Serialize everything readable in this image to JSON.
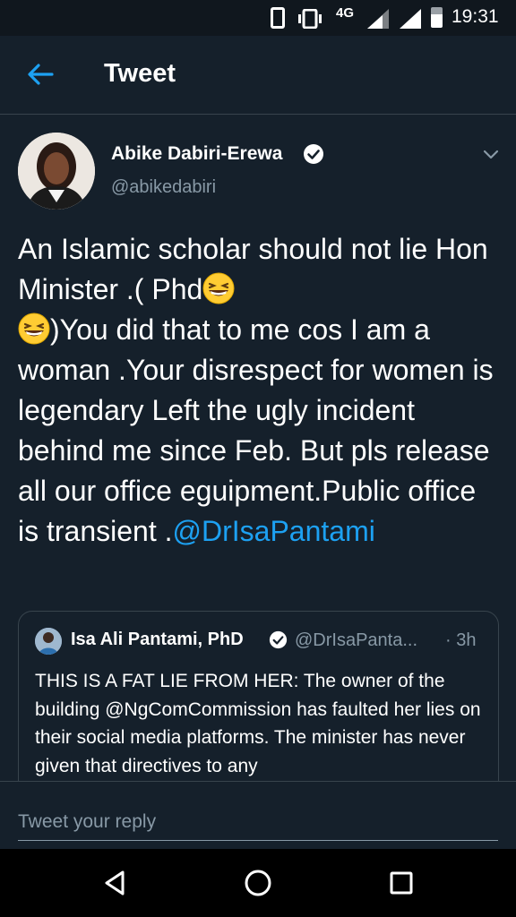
{
  "status_bar": {
    "network": "4G",
    "time": "19:31"
  },
  "header": {
    "title": "Tweet"
  },
  "tweet": {
    "author_name": "Abike Dabiri-Erewa",
    "author_handle": "@abikedabiri",
    "text_part1": "An Islamic scholar should not lie Hon Minister .( Phd",
    "text_part2": ")You did that to me cos  I am a woman .Your disrespect for women is legendary Left the ugly incident behind me since Feb. But pls release all our office eguipment.Public office is transient .",
    "mention": "@DrIsaPantami",
    "emoji": "grinning-squinting-face"
  },
  "quoted_tweet": {
    "author_name": "Isa Ali Pantami, PhD",
    "author_handle": "@DrIsaPanta...",
    "time": "· 3h",
    "text": "THIS IS A FAT LIE FROM HER: The owner of the building @NgComCommission has faulted her lies on their social media platforms. The minister has never given that directives to any"
  },
  "reply": {
    "placeholder": "Tweet your reply"
  },
  "colors": {
    "background": "#15202b",
    "accent": "#1da1f2",
    "secondary_text": "#8899a6",
    "divider": "#38444d"
  }
}
